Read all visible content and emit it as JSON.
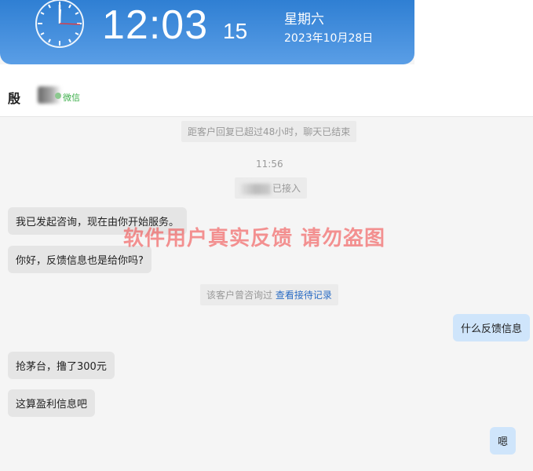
{
  "clock": {
    "time": "12:03",
    "seconds": "15",
    "weekday": "星期六",
    "date": "2023年10月28日"
  },
  "header": {
    "contact_name": "殷",
    "channel": "微信"
  },
  "chat": {
    "notice_48h": "距客户回复已超过48小时，聊天已结束",
    "time_stamp": "11:56",
    "joined_note": "已接入",
    "messages": [
      {
        "side": "left",
        "text": "我已发起咨询，现在由你开始服务。"
      },
      {
        "side": "left",
        "text": "你好，反馈信息也是给你吗?"
      },
      {
        "side": "right",
        "text": "什么反馈信息"
      },
      {
        "side": "left",
        "text": "抢茅台，撸了300元"
      },
      {
        "side": "left",
        "text": "这算盈利信息吧"
      },
      {
        "side": "right",
        "text": "嗯"
      }
    ],
    "history_note": "该客户曾咨询过",
    "history_link": "查看接待记录"
  },
  "watermark": "软件用户真实反馈  请勿盗图",
  "colors": {
    "banner_top": "#2f7fd3",
    "banner_bottom": "#5a9ee6",
    "bubble_left": "#e5e5e5",
    "bubble_right": "#cfe5fb",
    "link": "#2a6cc4",
    "watermark": "#f03c3c"
  }
}
